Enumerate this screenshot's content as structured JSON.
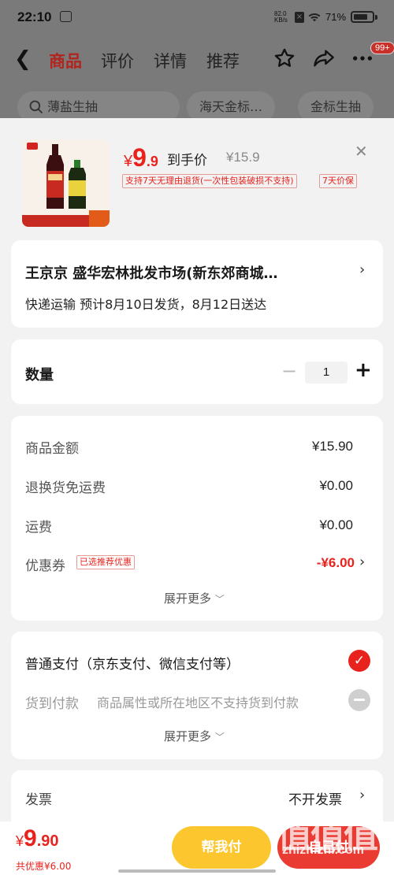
{
  "status_bar": {
    "time": "22:10",
    "net_speed_value": "82.0",
    "net_speed_unit": "KB/s",
    "battery": "71%"
  },
  "nav": {
    "tabs": [
      "商品",
      "评价",
      "详情",
      "推荐"
    ],
    "badge": "99+"
  },
  "chips": [
    "薄盐生抽",
    "海天金标…",
    "金标生抽"
  ],
  "product": {
    "price_symbol": "¥",
    "price_int": "9",
    "price_dec": ".9",
    "price_label": "到手价",
    "original_price": "¥15.9",
    "tags": [
      "支持7天无理由退货(一次性包装破损不支持)",
      "7天价保"
    ]
  },
  "address": {
    "title": "王京京  盛华宏林批发市场(新东郊商城…",
    "delivery": "快递运输 预计8月10日发货，8月12日送达"
  },
  "quantity": {
    "label": "数量",
    "value": "1"
  },
  "fees": {
    "rows": [
      {
        "label": "商品金额",
        "value": "¥15.90"
      },
      {
        "label": "退换货免运费",
        "value": "¥0.00"
      },
      {
        "label": "运费",
        "value": "¥0.00"
      }
    ],
    "coupon_label": "优惠券",
    "coupon_tag": "已选推荐优惠",
    "coupon_value": "-¥6.00",
    "more": "展开更多"
  },
  "payment": {
    "normal": "普通支付（京东支付、微信支付等）",
    "cod_label": "货到付款",
    "cod_desc": "商品属性或所在地区不支持货到付款",
    "more": "展开更多"
  },
  "invoice": {
    "label": "发票",
    "value": "不开发票"
  },
  "footer": {
    "symbol": "¥",
    "total_int": "9",
    "total_dec": ".90",
    "saved": "共优惠¥6.00",
    "help_pay": "帮我付",
    "self_pay": "自己付"
  },
  "watermark": {
    "brand_glyphs": "值值值",
    "domain": "zhizhizhi.com"
  },
  "colors": {
    "accent": "#e8231e",
    "help_button": "#fcc62f",
    "pay_button": "#ea3b33"
  }
}
